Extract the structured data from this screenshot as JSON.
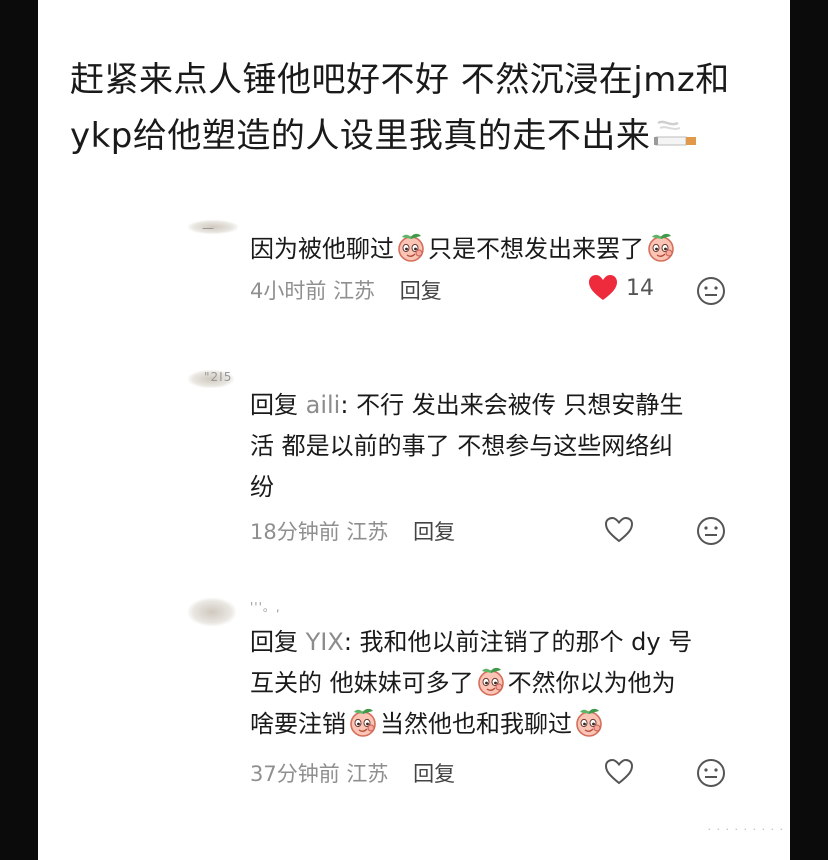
{
  "post": {
    "line1": "赶紧来点人锤他吧好不好 不然沉浸在jmz和",
    "line2": "ykp给他塑造的人设里我真的走不出来"
  },
  "comments": [
    {
      "user_hint": "一",
      "segments": [
        "因为被他聊过",
        "只是不想发出来罢了"
      ],
      "time": "4小时前",
      "location": "江苏",
      "reply_label": "回复",
      "likes": "14",
      "liked": true
    },
    {
      "user_hint": "\"2Ⅰ5",
      "reply_prefix": "回复",
      "reply_to": "aili",
      "line1": ": 不行 发出来会被传 只想安静生",
      "line2": "活 都是以前的事了 不想参与这些网络纠",
      "line3": "纷",
      "time": "18分钟前",
      "location": "江苏",
      "reply_label": "回复",
      "liked": false
    },
    {
      "user_hint": "'''。,",
      "reply_prefix": "回复",
      "reply_to": "YIX",
      "line1": ": 我和他以前注销了的那个 dy 号",
      "line2a": "互关的 他妹妹可多了",
      "line2b": "不然你以为他为",
      "line3a": "啥要注销",
      "line3b": "当然他也和我聊过",
      "time": "37分钟前",
      "location": "江苏",
      "reply_label": "回复",
      "liked": false
    }
  ],
  "colors": {
    "heart_active": "#ee2a3d",
    "meta_gray": "#8f8f8f",
    "peach": "#f6b3a5"
  },
  "watermark": "· · · · · · · · ·"
}
